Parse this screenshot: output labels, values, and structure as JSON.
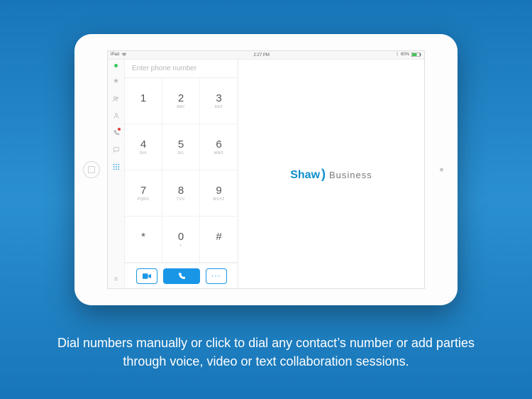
{
  "status_bar": {
    "carrier": "iPad",
    "wifi_icon": "wifi",
    "time": "2:27 PM",
    "battery_text": "60%",
    "battery_icon": "battery"
  },
  "sidebar": {
    "items": [
      {
        "name": "presence-indicator"
      },
      {
        "name": "favorites-icon"
      },
      {
        "name": "groups-icon"
      },
      {
        "name": "contacts-icon"
      },
      {
        "name": "calls-icon"
      },
      {
        "name": "chat-icon"
      },
      {
        "name": "dialpad-icon"
      }
    ],
    "bottom": {
      "name": "menu-icon"
    }
  },
  "dialer": {
    "placeholder": "Enter phone number",
    "keys": [
      {
        "digit": "1",
        "letters": ""
      },
      {
        "digit": "2",
        "letters": "ABC"
      },
      {
        "digit": "3",
        "letters": "DEF"
      },
      {
        "digit": "4",
        "letters": "GHI"
      },
      {
        "digit": "5",
        "letters": "JKL"
      },
      {
        "digit": "6",
        "letters": "MNO"
      },
      {
        "digit": "7",
        "letters": "PQRS"
      },
      {
        "digit": "8",
        "letters": "TUV"
      },
      {
        "digit": "9",
        "letters": "WXYZ"
      },
      {
        "digit": "*",
        "letters": ""
      },
      {
        "digit": "0",
        "letters": "+"
      },
      {
        "digit": "#",
        "letters": ""
      }
    ],
    "actions": {
      "video": "video",
      "call": "call",
      "more": "···"
    }
  },
  "brand": {
    "name": "Shaw",
    "paren": ")",
    "suffix": "Business"
  },
  "caption": "Dial numbers manually or click to dial any contact’s number or add parties through voice, video or text collaboration sessions."
}
